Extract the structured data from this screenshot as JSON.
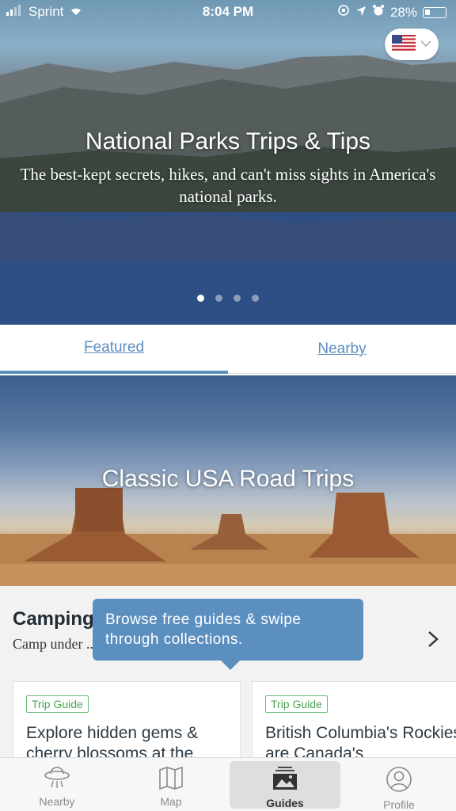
{
  "status_bar": {
    "carrier": "Sprint",
    "time": "8:04 PM",
    "battery": "28%"
  },
  "hero": {
    "title": "National Parks Trips & Tips",
    "subtitle": "The best-kept secrets, hikes, and can't miss sights in America's national parks.",
    "page_count": 4,
    "active_page": 1,
    "country_flag": "us-flag-icon"
  },
  "tabs": [
    {
      "label": "Featured",
      "active": true
    },
    {
      "label": "Nearby",
      "active": false
    }
  ],
  "feature": {
    "title": "Classic USA Road Trips"
  },
  "section": {
    "title": "Camping",
    "description": "Camp under ... for aliens..."
  },
  "tooltip": {
    "text": "Browse free guides & swipe through collections."
  },
  "cards": [
    {
      "badge": "Trip Guide",
      "title": "Explore hidden gems & cherry blossoms at the"
    },
    {
      "badge": "Trip Guide",
      "title": "British Columbia's Rockies are Canada's"
    }
  ],
  "nav": [
    {
      "label": "Nearby",
      "icon": "ufo-icon",
      "active": false
    },
    {
      "label": "Map",
      "icon": "map-icon",
      "active": false
    },
    {
      "label": "Guides",
      "icon": "guides-icon",
      "active": true
    },
    {
      "label": "Profile",
      "icon": "profile-icon",
      "active": false
    }
  ],
  "colors": {
    "accent": "#5b8fbf",
    "badge_green": "#4aa553"
  }
}
